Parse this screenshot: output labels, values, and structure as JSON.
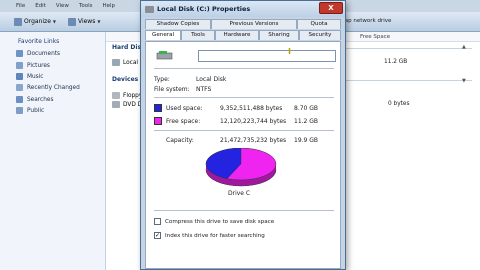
{
  "explorer": {
    "menu": [
      "File",
      "Edit",
      "View",
      "Tools",
      "Help"
    ],
    "toolbar": {
      "organize": "Organize",
      "views": "Views",
      "map_network": "Map network drive"
    },
    "nav": {
      "title": "Favorite Links",
      "items": [
        "Documents",
        "Pictures",
        "Music",
        "Recently Changed",
        "Searches",
        "Public"
      ]
    },
    "content": {
      "col_free_space": "Free Space",
      "group_hard_disk": "Hard Disk",
      "local_disk_label": "Local D",
      "local_disk_free": "11.2 GB",
      "group_devices": "Devices",
      "floppy_label": "Floppy",
      "dvd_label": "DVD D",
      "dvd_free": "0 bytes"
    }
  },
  "dialog": {
    "title": "Local Disk (C:) Properties",
    "close_label": "X",
    "tabs_top": [
      "Shadow Copies",
      "Previous Versions",
      "Quota"
    ],
    "tabs_bottom": [
      "General",
      "Tools",
      "Hardware",
      "Sharing",
      "Security"
    ],
    "active_tab": "General",
    "volume_name": "",
    "type_label": "Type:",
    "type_value": "Local Disk",
    "fs_label": "File system:",
    "fs_value": "NTFS",
    "used_label": "Used space:",
    "used_bytes": "9,352,511,488 bytes",
    "used_gb": "8.70 GB",
    "free_label": "Free space:",
    "free_bytes": "12,120,223,744 bytes",
    "free_gb": "11.2 GB",
    "capacity_label": "Capacity:",
    "capacity_bytes": "21,472,735,232 bytes",
    "capacity_gb": "19.9 GB",
    "drive_label": "Drive C",
    "compress_label": "Compress this drive to save disk space",
    "index_label": "Index this drive for faster searching",
    "compress_checked": false,
    "index_checked": true,
    "colors": {
      "used": "#2323e0",
      "free": "#f024f0"
    },
    "used_fraction": 0.4355
  }
}
